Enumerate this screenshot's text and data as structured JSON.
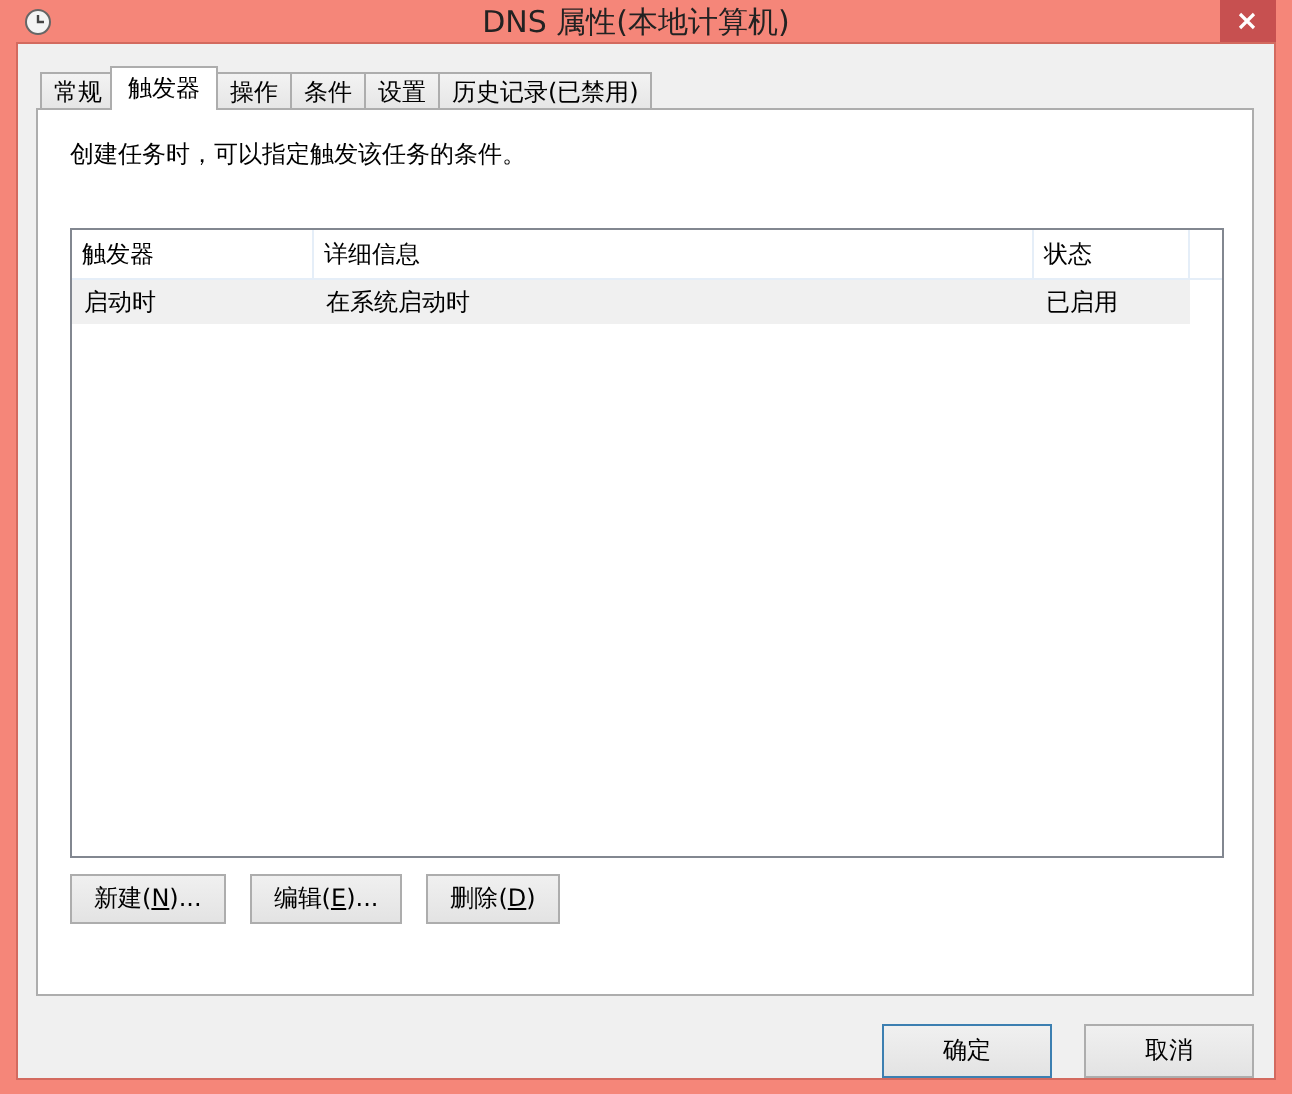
{
  "window": {
    "title": "DNS 属性(本地计算机)"
  },
  "tabs": [
    {
      "label": "常规",
      "selected": false
    },
    {
      "label": "触发器",
      "selected": true
    },
    {
      "label": "操作",
      "selected": false
    },
    {
      "label": "条件",
      "selected": false
    },
    {
      "label": "设置",
      "selected": false
    },
    {
      "label": "历史记录(已禁用)",
      "selected": false
    }
  ],
  "description": "创建任务时，可以指定触发该任务的条件。",
  "table": {
    "columns": [
      "触发器",
      "详细信息",
      "状态"
    ],
    "rows": [
      {
        "cells": [
          "启动时",
          "在系统启动时",
          "已启用"
        ],
        "selected": true
      }
    ]
  },
  "actions": [
    {
      "before": "新建(",
      "key": "N",
      "after": ")..."
    },
    {
      "before": "编辑(",
      "key": "E",
      "after": ")..."
    },
    {
      "before": "删除(",
      "key": "D",
      "after": ")"
    }
  ],
  "buttons": [
    {
      "label": "确定",
      "default": true
    },
    {
      "label": "取消",
      "default": false
    }
  ]
}
